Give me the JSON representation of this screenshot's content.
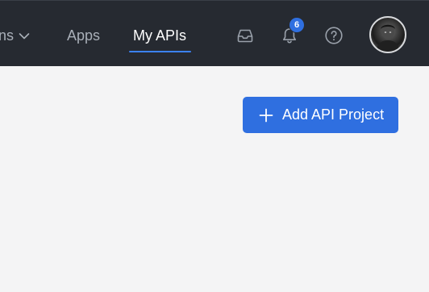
{
  "nav": {
    "partial_label": "ns",
    "apps_label": "Apps",
    "my_apis_label": "My APIs",
    "active_item": "My APIs"
  },
  "icons": {
    "dropdown": "chevron-down-icon",
    "inbox": "inbox-icon",
    "notifications": "bell-icon",
    "help": "help-circle-icon",
    "add": "plus-icon"
  },
  "notifications": {
    "count": "6"
  },
  "actions": {
    "add_project_label": "Add API Project"
  },
  "colors": {
    "topbar": "#262a31",
    "accent": "#2f6fe0",
    "underline": "#3b82f6",
    "background": "#f4f4f5"
  }
}
